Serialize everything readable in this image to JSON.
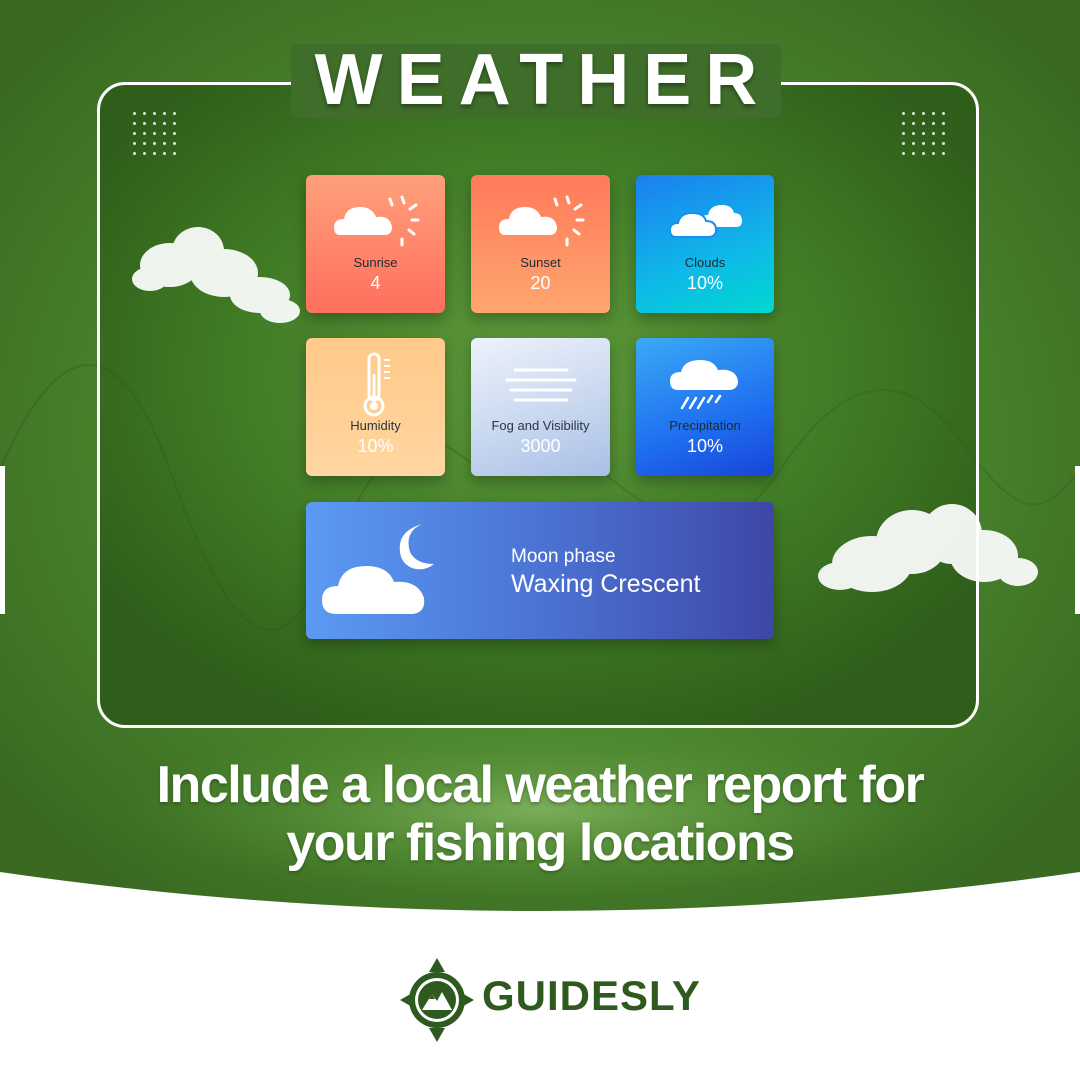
{
  "title": "WEATHER",
  "tiles": [
    {
      "label": "Sunrise",
      "value": "4",
      "icon": "cloud-sun-icon"
    },
    {
      "label": "Sunset",
      "value": "20",
      "icon": "cloud-sun-icon"
    },
    {
      "label": "Clouds",
      "value": "10%",
      "icon": "clouds-icon"
    },
    {
      "label": "Humidity",
      "value": "10%",
      "icon": "thermometer-icon"
    },
    {
      "label": "Fog and Visibility",
      "value": "3000",
      "icon": "fog-icon"
    },
    {
      "label": "Precipitation",
      "value": "10%",
      "icon": "rain-cloud-icon"
    }
  ],
  "moon": {
    "label": "Moon phase",
    "value": "Waxing Crescent",
    "icon": "cloud-moon-icon"
  },
  "headline": {
    "line1": "Include a local weather report for",
    "line2": "your fishing locations"
  },
  "brand": {
    "name": "GUIDESLY"
  },
  "colors": {
    "background_green": "#3f7a25",
    "brand_green": "#2f5a1f",
    "sunrise_tile": "#ff7a5a",
    "clouds_tile": "#1b8ff0",
    "humidity_tile": "#ffc98a",
    "fog_tile": "#c9d8f0",
    "precipitation_tile": "#1f6ff0",
    "moon_tile": "#4a6fd0"
  }
}
